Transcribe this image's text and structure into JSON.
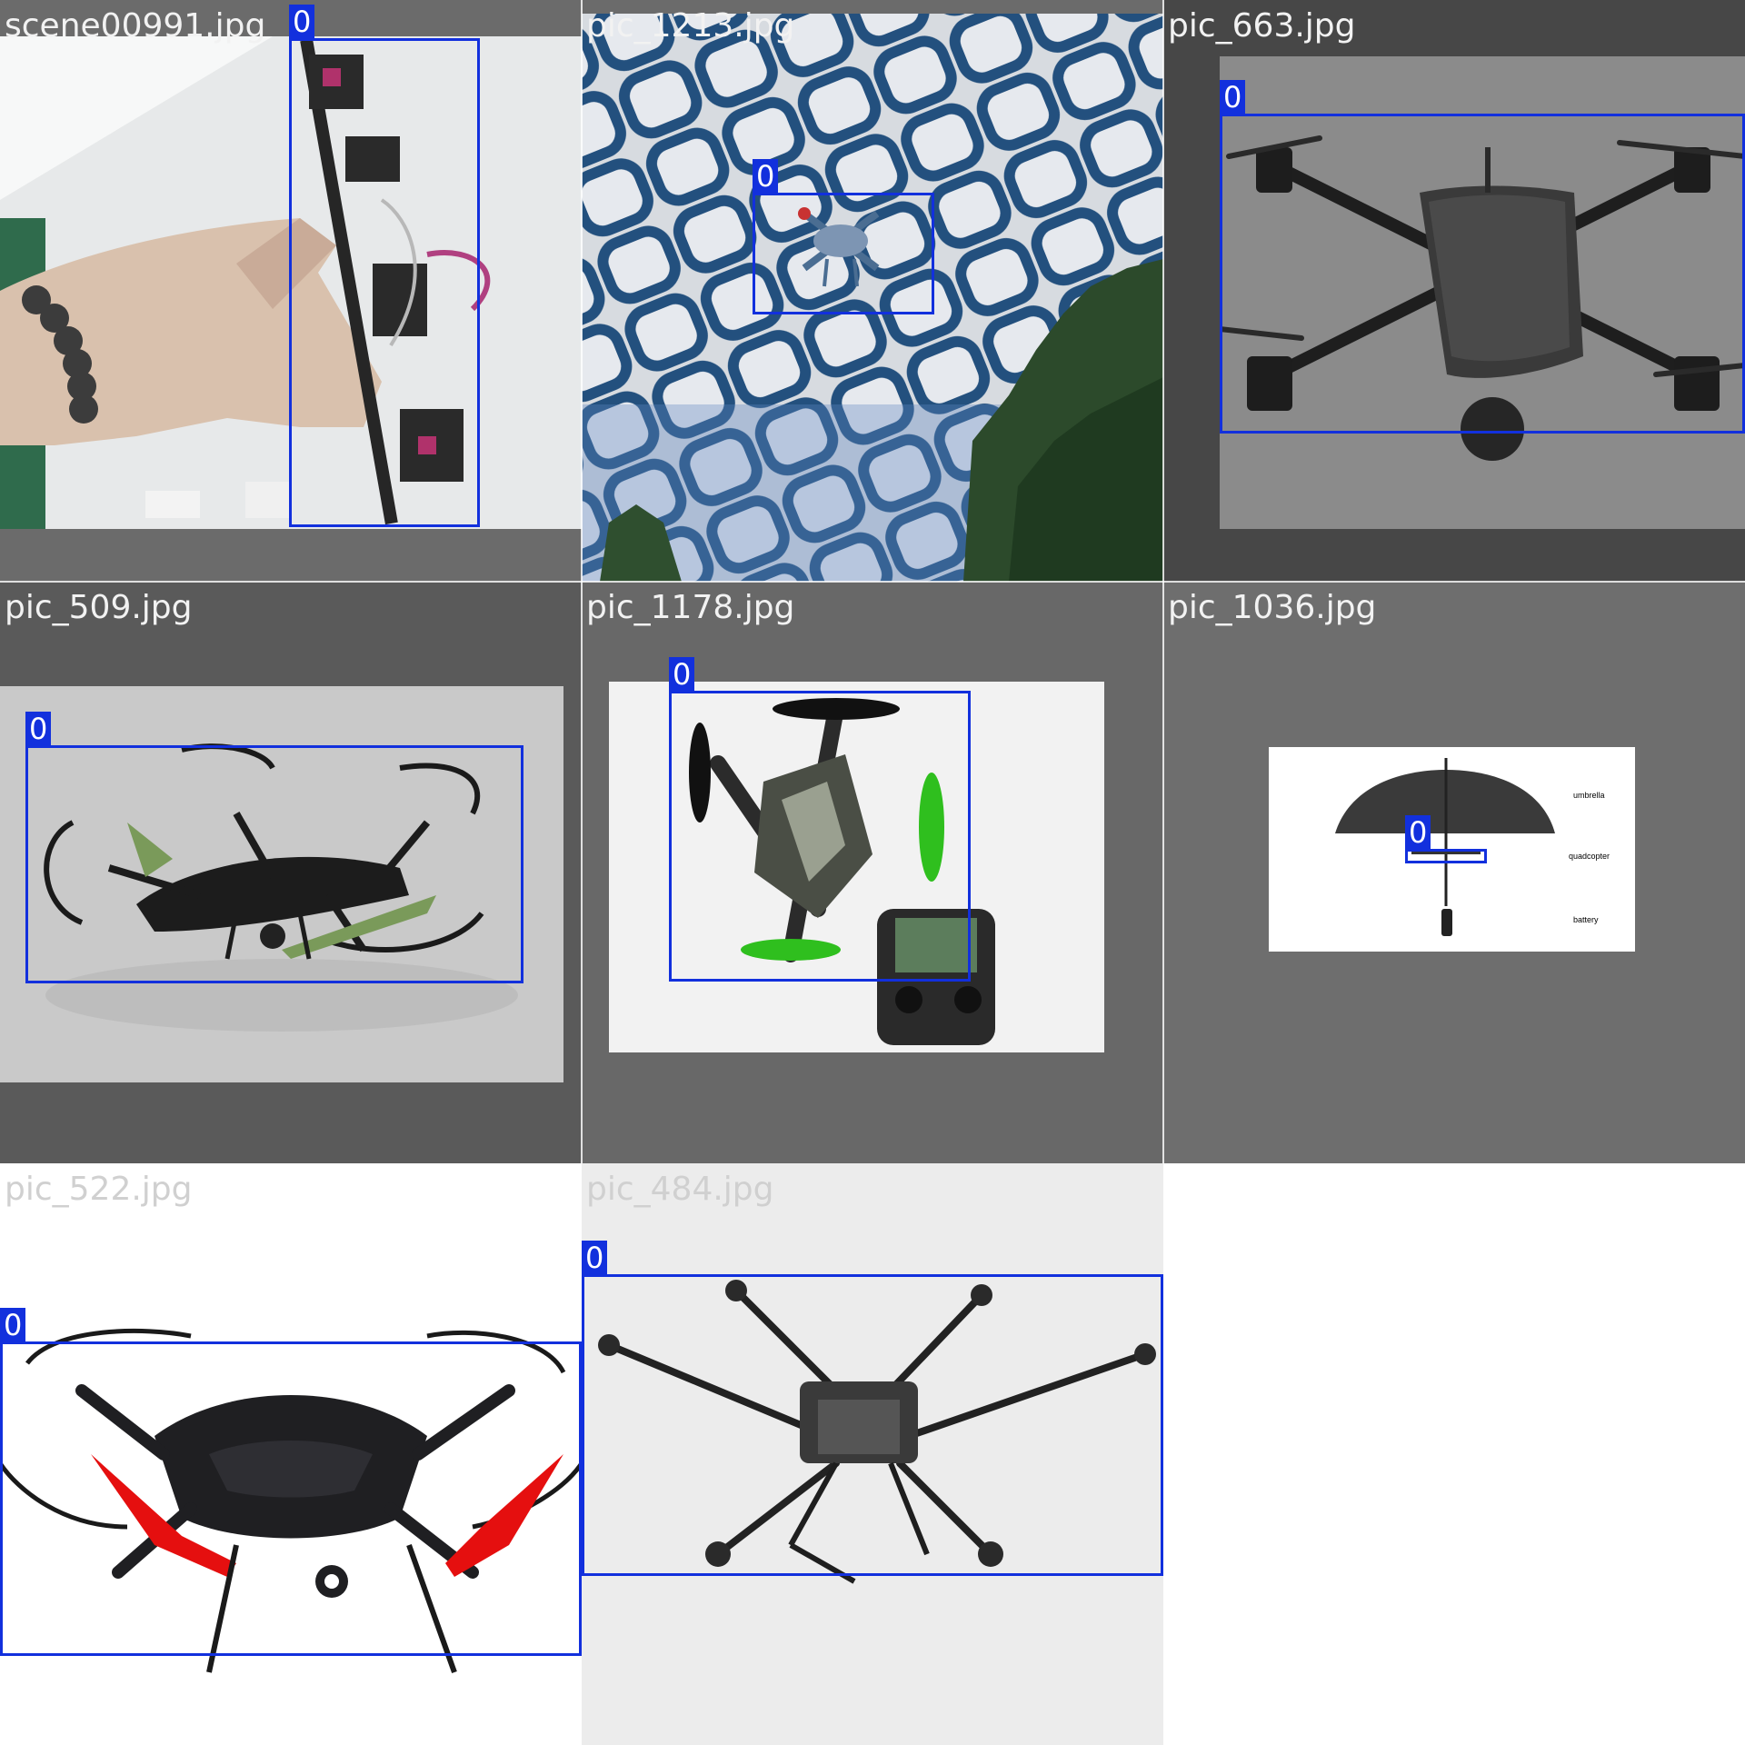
{
  "mosaic": {
    "tiles": [
      {
        "filename": "scene00991.jpg",
        "class_label": "0"
      },
      {
        "filename": "pic_1213.jpg",
        "class_label": "0"
      },
      {
        "filename": "pic_663.jpg",
        "class_label": "0"
      },
      {
        "filename": "pic_509.jpg",
        "class_label": "0"
      },
      {
        "filename": "pic_1178.jpg",
        "class_label": "0"
      },
      {
        "filename": "pic_1036.jpg",
        "class_label": "0",
        "diagram_labels": {
          "umbrella": "umbrella",
          "quadcopter": "quadcopter",
          "battery": "battery"
        }
      },
      {
        "filename": "pic_522.jpg",
        "class_label": "0"
      },
      {
        "filename": "pic_484.jpg",
        "class_label": "0"
      }
    ]
  },
  "colors": {
    "bbox": "#1230dd",
    "padding_gray": "#6b6b6b",
    "padding_dark": "#474747"
  }
}
